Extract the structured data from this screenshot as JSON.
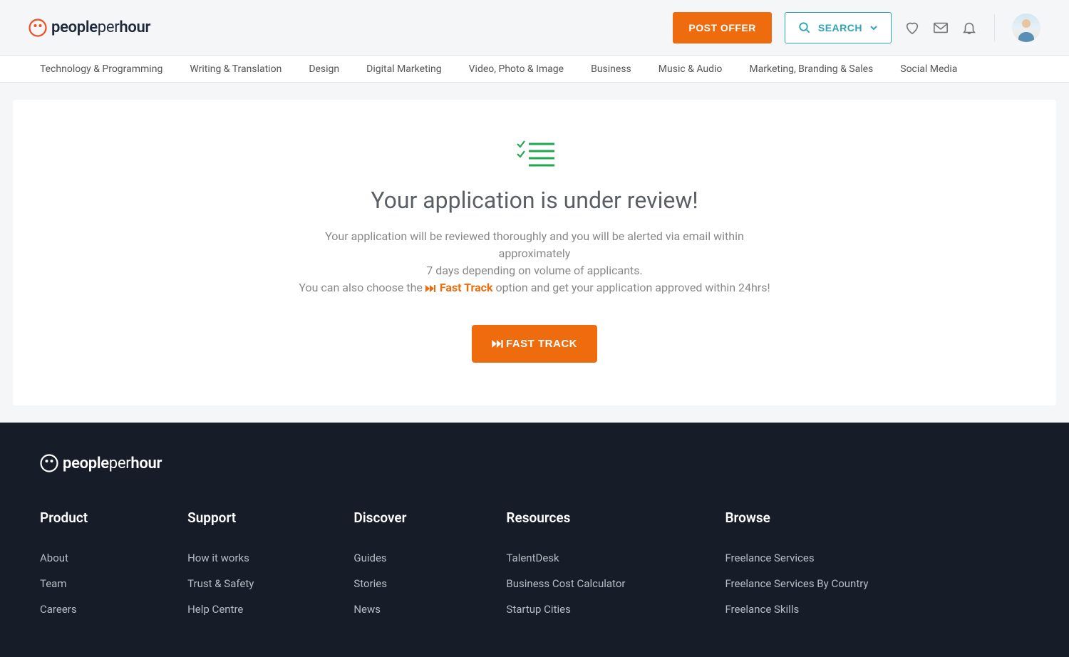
{
  "header": {
    "logo_people": "people",
    "logo_per": "per",
    "logo_hour": "hour",
    "post_offer": "POST OFFER",
    "search": "SEARCH"
  },
  "nav": {
    "items": [
      "Technology & Programming",
      "Writing & Translation",
      "Design",
      "Digital Marketing",
      "Video, Photo & Image",
      "Business",
      "Music & Audio",
      "Marketing, Branding & Sales",
      "Social Media"
    ]
  },
  "main": {
    "title": "Your application is under review!",
    "line1": "Your application will be reviewed thoroughly and you will be alerted via email within approximately",
    "line2": "7 days depending on volume of applicants.",
    "line3_pre": "You can also choose the ",
    "fast_track_link": "Fast Track",
    "line3_post": " option and get your application approved within 24hrs!",
    "fast_track_btn": "FAST TRACK"
  },
  "footer": {
    "logo_people": "people",
    "logo_per": "per",
    "logo_hour": "hour",
    "cols": [
      {
        "title": "Product",
        "items": [
          "About",
          "Team",
          "Careers"
        ]
      },
      {
        "title": "Support",
        "items": [
          "How it works",
          "Trust & Safety",
          "Help Centre"
        ]
      },
      {
        "title": "Discover",
        "items": [
          "Guides",
          "Stories",
          "News"
        ]
      },
      {
        "title": "Resources",
        "items": [
          "TalentDesk",
          "Business Cost Calculator",
          "Startup Cities"
        ]
      },
      {
        "title": "Browse",
        "items": [
          "Freelance Services",
          "Freelance Services By Country",
          "Freelance Skills"
        ]
      }
    ]
  }
}
